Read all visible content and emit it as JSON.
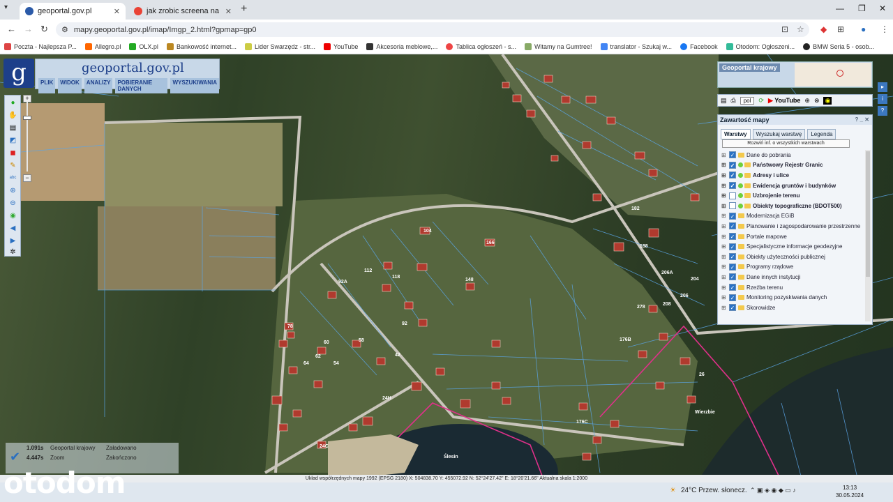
{
  "browser": {
    "tabs": [
      {
        "title": "geoportal.gov.pl",
        "active": true
      },
      {
        "title": "jak zrobic screena na pc - Szuka",
        "active": false
      }
    ],
    "url": "mapy.geoportal.gov.pl/imap/Imgp_2.html?gpmap=gp0",
    "bookmarks": [
      "Poczta - Najlepsza P...",
      "Allegro.pl",
      "OLX.pl",
      "Bankowość internet...",
      "Lider Swarzędz - str...",
      "YouTube",
      "Akcesoria meblowe,...",
      "Tablica ogłoszeń - s...",
      "Witamy na Gumtree!",
      "translator - Szukaj w...",
      "Facebook",
      "Otodom: Ogłoszeni...",
      "BMW Seria 5 - osob..."
    ]
  },
  "app": {
    "brand": "geoportal.gov.pl",
    "menu": [
      "PLIK",
      "WIDOK",
      "ANALIZY",
      "POBIERANIE DANYCH",
      "WYSZUKIWANIA"
    ],
    "minimap_title": "Geoportal krajowy",
    "language": "pol",
    "youtube_label": "YouTube"
  },
  "panel": {
    "title": "Zawartość mapy",
    "tabs": [
      "Warstwy",
      "Wyszukaj warstwę",
      "Legenda"
    ],
    "expand_label": "Rozwiń inf. o wszystkich warstwach",
    "layers": [
      {
        "label": "Dane do pobrania",
        "checked": true,
        "bold": false
      },
      {
        "label": "Państwowy Rejestr Granic",
        "checked": true,
        "bold": true
      },
      {
        "label": "Adresy i ulice",
        "checked": true,
        "bold": true
      },
      {
        "label": "Ewidencja gruntów i budynków",
        "checked": true,
        "bold": true
      },
      {
        "label": "Uzbrojenie terenu",
        "checked": false,
        "bold": true
      },
      {
        "label": "Obiekty topograficzne (BDOT500)",
        "checked": false,
        "bold": true
      },
      {
        "label": "Modernizacja EGiB",
        "checked": true,
        "bold": false
      },
      {
        "label": "Planowanie i zagospodarowanie przestrzenne",
        "checked": true,
        "bold": false
      },
      {
        "label": "Portale mapowe",
        "checked": true,
        "bold": false
      },
      {
        "label": "Specjalistyczne informacje geodezyjne",
        "checked": true,
        "bold": false
      },
      {
        "label": "Obiekty użyteczności publicznej",
        "checked": true,
        "bold": false
      },
      {
        "label": "Programy rządowe",
        "checked": true,
        "bold": false
      },
      {
        "label": "Dane innych instytucji",
        "checked": true,
        "bold": false
      },
      {
        "label": "Rzeźba terenu",
        "checked": true,
        "bold": false
      },
      {
        "label": "Monitoring pozyskiwania danych",
        "checked": true,
        "bold": false
      },
      {
        "label": "Skorowidze",
        "checked": true,
        "bold": false
      }
    ]
  },
  "status": [
    {
      "time": "1.091s",
      "name": "Geoportal krajowy",
      "state": "Załadowano"
    },
    {
      "time": "4.447s",
      "name": "Zoom",
      "state": "Zakończono"
    }
  ],
  "coords": "Układ współrzędnych mapy 1992 (EPSG 2180)   X: 504838.70 Y: 455072.92   N: 52°24'27.42\" E: 18°20'21.66\"   Aktualna skala 1:2000",
  "map_labels": [
    "104",
    "166",
    "112",
    "92A",
    "118",
    "148",
    "92",
    "78",
    "60",
    "64",
    "62",
    "54",
    "58",
    "42",
    "24H",
    "24C",
    "182",
    "188",
    "206A",
    "204",
    "208",
    "206",
    "278",
    "176B",
    "176C",
    "26",
    "Ślesin",
    "Wierzbie"
  ],
  "taskbar": {
    "weather": "24°C  Przew. słonecz.",
    "time": "13:13",
    "date": "30.05.2024"
  },
  "watermark": "otodom"
}
